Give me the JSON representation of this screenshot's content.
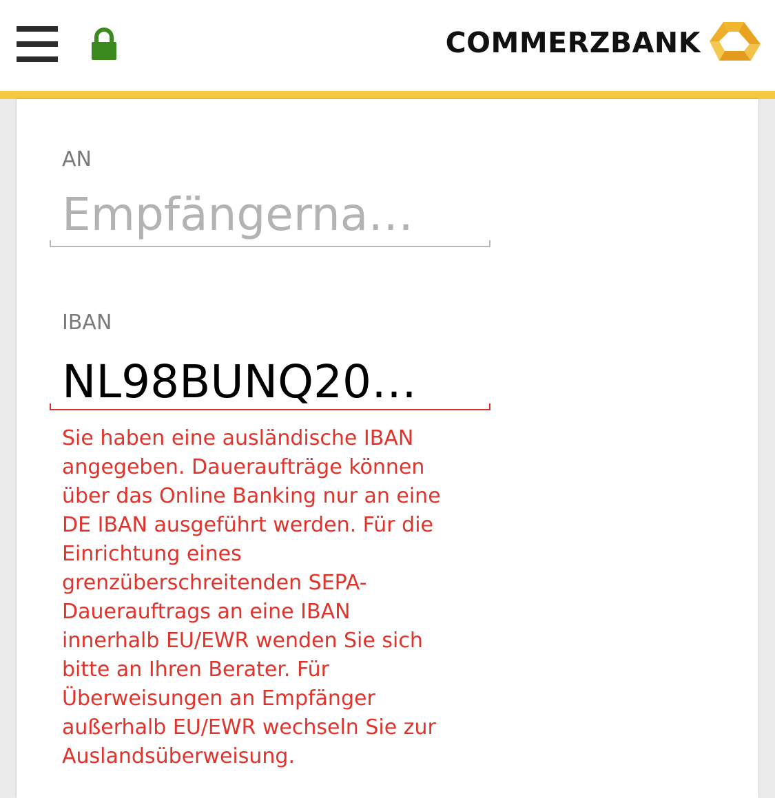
{
  "header": {
    "brand_name": "COMMERZBANK",
    "accent_color": "#f5c842",
    "lock_color": "#3b8a1e",
    "menu_icon": "hamburger-menu-icon",
    "lock_icon": "lock-icon",
    "logo_icon": "commerzbank-ribbon-logo-icon"
  },
  "form": {
    "recipient": {
      "label": "AN",
      "placeholder": "Empfängerna…",
      "value": ""
    },
    "iban": {
      "label": "IBAN",
      "value": "NL98BUNQ20…",
      "error_color": "#e0332b",
      "error_lines": [
        "Sie haben eine ausländische IBAN",
        "angegeben. Daueraufträge können",
        "über das Online Banking nur an eine",
        "DE IBAN ausgeführt werden. Für die",
        "Einrichtung eines",
        "grenzüberschreitenden SEPA-",
        "Dauerauftrags an eine IBAN",
        "innerhalb EU/EWR wenden Sie sich",
        "bitte an Ihren Berater. Für",
        "Überweisungen an Empfänger",
        "außerhalb EU/EWR wechseln Sie zur",
        "Auslandsüberweisung."
      ]
    }
  }
}
